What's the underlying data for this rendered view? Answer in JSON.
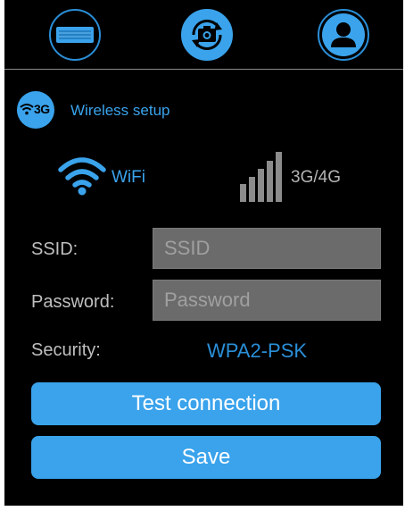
{
  "top_bar": {
    "icons": [
      "device-icon",
      "camera-rotate-icon",
      "user-icon"
    ],
    "active_icon": "camera-rotate-icon"
  },
  "header": {
    "badge_text": "3G",
    "title": "Wireless setup"
  },
  "network_options": {
    "wifi_label": "WiFi",
    "cellular_label": "3G/4G",
    "selected": "WiFi"
  },
  "form": {
    "ssid_label": "SSID:",
    "ssid_placeholder": "SSID",
    "ssid_value": "",
    "password_label": "Password:",
    "password_placeholder": "Password",
    "password_value": "",
    "security_label": "Security:",
    "security_value": "WPA2-PSK"
  },
  "buttons": {
    "test_label": "Test connection",
    "save_label": "Save"
  },
  "colors": {
    "accent": "#3aa3ec",
    "background": "#000000",
    "input_bg": "#6b6b6b",
    "label_text": "#bfbfbf"
  }
}
